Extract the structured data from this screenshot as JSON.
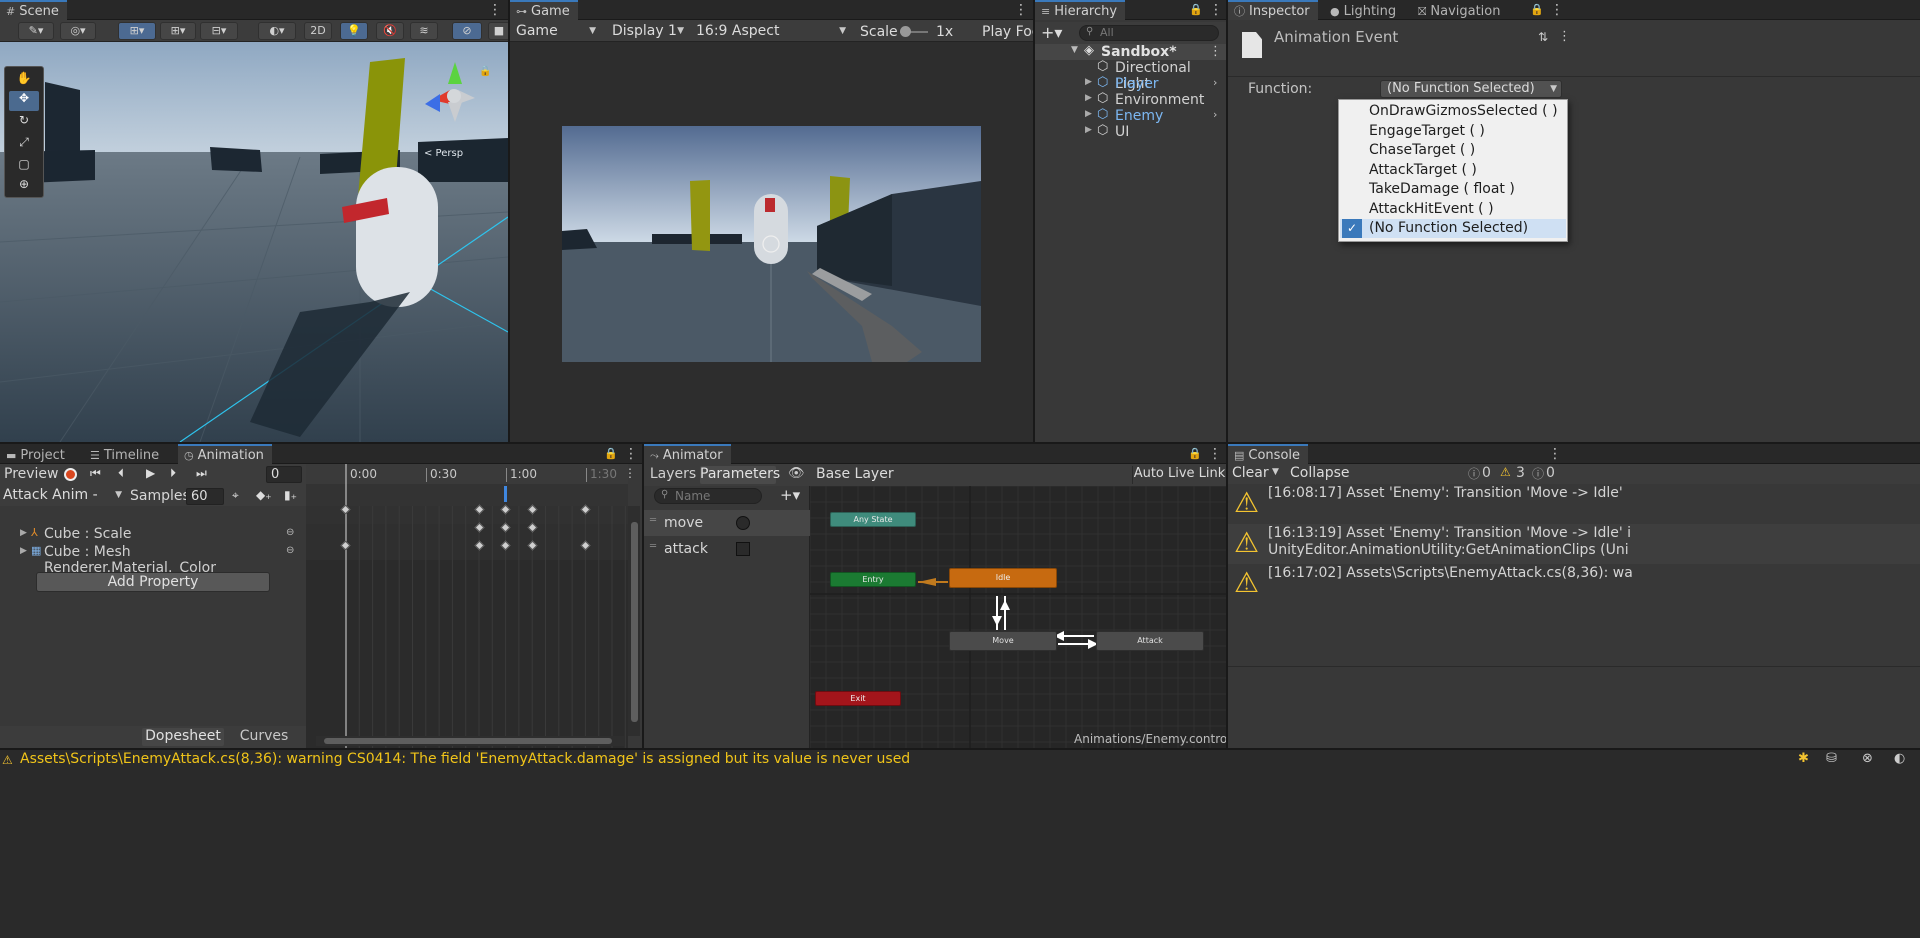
{
  "scene": {
    "tab_label": "Scene",
    "tab_icon": "grid-icon",
    "btn_2d": "2D",
    "persp_label": "< Persp"
  },
  "game": {
    "tab_label": "Game",
    "display_mode": "Game",
    "display": "Display 1",
    "aspect": "16:9 Aspect",
    "scale_label": "Scale",
    "scale_value": "1x",
    "play_focus": "Play Focu"
  },
  "hierarchy": {
    "tab_label": "Hierarchy",
    "search_placeholder": "All",
    "root": "Sandbox*",
    "items": [
      {
        "label": "Directional Light",
        "prefab": false,
        "expandable": false
      },
      {
        "label": "Player",
        "prefab": true,
        "expandable": true
      },
      {
        "label": "Environment",
        "prefab": false,
        "expandable": true
      },
      {
        "label": "Enemy",
        "prefab": true,
        "expandable": true
      },
      {
        "label": "UI",
        "prefab": false,
        "expandable": true
      }
    ]
  },
  "inspector": {
    "tabs": [
      "Inspector",
      "Lighting",
      "Navigation"
    ],
    "header_title": "Animation Event",
    "function_label": "Function:",
    "function_value": "(No Function Selected)",
    "menu_options": [
      {
        "label": "OnDrawGizmosSelected ( )",
        "checked": false
      },
      {
        "label": "EngageTarget ( )",
        "checked": false
      },
      {
        "label": "ChaseTarget ( )",
        "checked": false
      },
      {
        "label": "AttackTarget ( )",
        "checked": false
      },
      {
        "label": "TakeDamage ( float )",
        "checked": false
      },
      {
        "label": "AttackHitEvent ( )",
        "checked": false
      },
      {
        "label": "(No Function Selected)",
        "checked": true
      }
    ]
  },
  "animation": {
    "tabs": [
      "Project",
      "Timeline",
      "Animation"
    ],
    "preview_label": "Preview",
    "frame_value": "0",
    "clip_name": "Attack Anim - Plac",
    "samples_label": "Samples",
    "samples_value": "60",
    "properties": [
      "Cube : Scale",
      "Cube : Mesh Renderer.Material._Color"
    ],
    "add_property": "Add Property",
    "bottom_tabs": [
      "Dopesheet",
      "Curves"
    ],
    "time_labels": [
      "0:00",
      "0:30",
      "1:00",
      "1:30"
    ]
  },
  "animator": {
    "tab_label": "Animator",
    "subtabs": [
      "Layers",
      "Parameters"
    ],
    "base_layer": "Base Layer",
    "auto_live": "Auto Live Link",
    "name_placeholder": "Name",
    "params": [
      {
        "name": "move",
        "type": "float"
      },
      {
        "name": "attack",
        "type": "trigger"
      }
    ],
    "states": {
      "any": "Any State",
      "entry": "Entry",
      "idle": "Idle",
      "move": "Move",
      "attack": "Attack",
      "exit": "Exit"
    },
    "footer_path": "Animations/Enemy.controller"
  },
  "console": {
    "tab_label": "Console",
    "clear": "Clear",
    "collapse": "Collapse",
    "count_info": "0",
    "count_warn": "3",
    "count_error": "0",
    "messages": [
      {
        "line1": "[16:08:17] Asset 'Enemy': Transition 'Move -> Idle'",
        "line2": ""
      },
      {
        "line1": "[16:13:19] Asset 'Enemy': Transition 'Move -> Idle' i",
        "line2": "UnityEditor.AnimationUtility:GetAnimationClips (Uni"
      },
      {
        "line1": "[16:17:02] Assets\\Scripts\\EnemyAttack.cs(8,36): wa",
        "line2": ""
      }
    ]
  },
  "status_bar": {
    "message": "Assets\\Scripts\\EnemyAttack.cs(8,36): warning CS0414: The field 'EnemyAttack.damage' is assigned but its value is never used"
  },
  "colors": {
    "accent": "#3a79bb",
    "prefab_blue": "#7cb7f2",
    "warning": "#f4c430",
    "state_entry": "#1b7a32",
    "state_idle": "#c76a10",
    "state_any": "#3f8b7c",
    "state_exit": "#a3151b"
  }
}
